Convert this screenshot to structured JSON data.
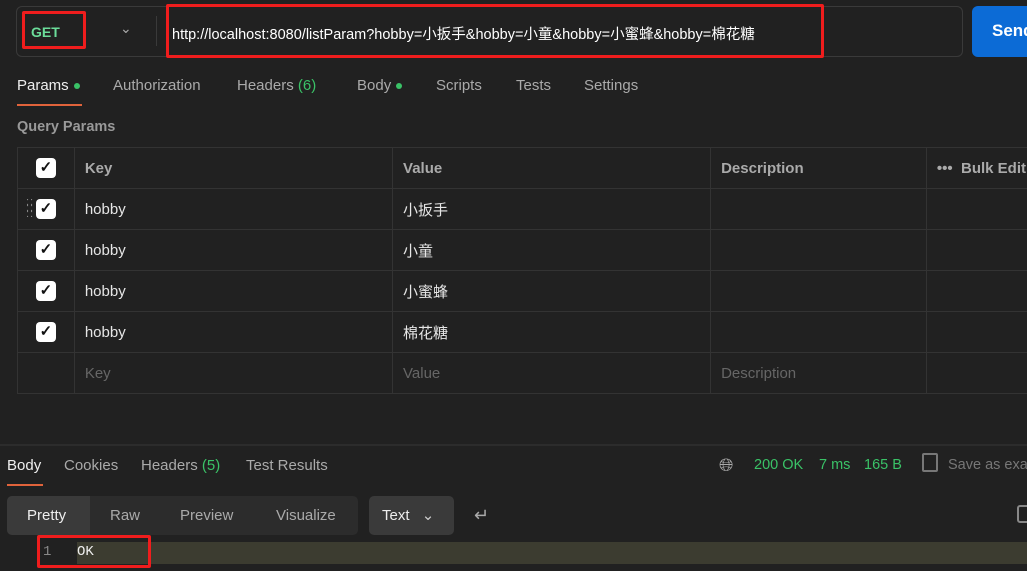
{
  "request": {
    "method": "GET",
    "url": "http://localhost:8080/listParam?hobby=小扳手&hobby=小童&hobby=小蜜蜂&hobby=棉花糖",
    "send_label": "Send"
  },
  "tabs": [
    {
      "label": "Params",
      "dot": true
    },
    {
      "label": "Authorization"
    },
    {
      "label": "Headers",
      "count": "(6)"
    },
    {
      "label": "Body",
      "dot": true
    },
    {
      "label": "Scripts"
    },
    {
      "label": "Tests"
    },
    {
      "label": "Settings"
    }
  ],
  "query_params": {
    "title": "Query Params",
    "headers": [
      "Key",
      "Value",
      "Description",
      "Bulk Edit"
    ],
    "rows": [
      {
        "key": "hobby",
        "value": "小扳手"
      },
      {
        "key": "hobby",
        "value": "小童"
      },
      {
        "key": "hobby",
        "value": "小蜜蜂"
      },
      {
        "key": "hobby",
        "value": "棉花糖"
      }
    ],
    "placeholders": {
      "key": "Key",
      "value": "Value",
      "description": "Description"
    }
  },
  "response": {
    "tabs": [
      {
        "label": "Body"
      },
      {
        "label": "Cookies"
      },
      {
        "label": "Headers",
        "count": "(5)"
      },
      {
        "label": "Test Results"
      }
    ],
    "status": "200 OK",
    "time": "7 ms",
    "size": "165 B",
    "save_label": "Save as example",
    "views": [
      "Pretty",
      "Raw",
      "Preview",
      "Visualize"
    ],
    "format": "Text",
    "lines": [
      {
        "n": "1",
        "text": "OK"
      }
    ]
  },
  "colors": {
    "accent": "#e0633b",
    "send": "#0c6bd6",
    "success": "#3ac267",
    "method": "#6bdd9a",
    "annotation": "#f01d1d"
  }
}
